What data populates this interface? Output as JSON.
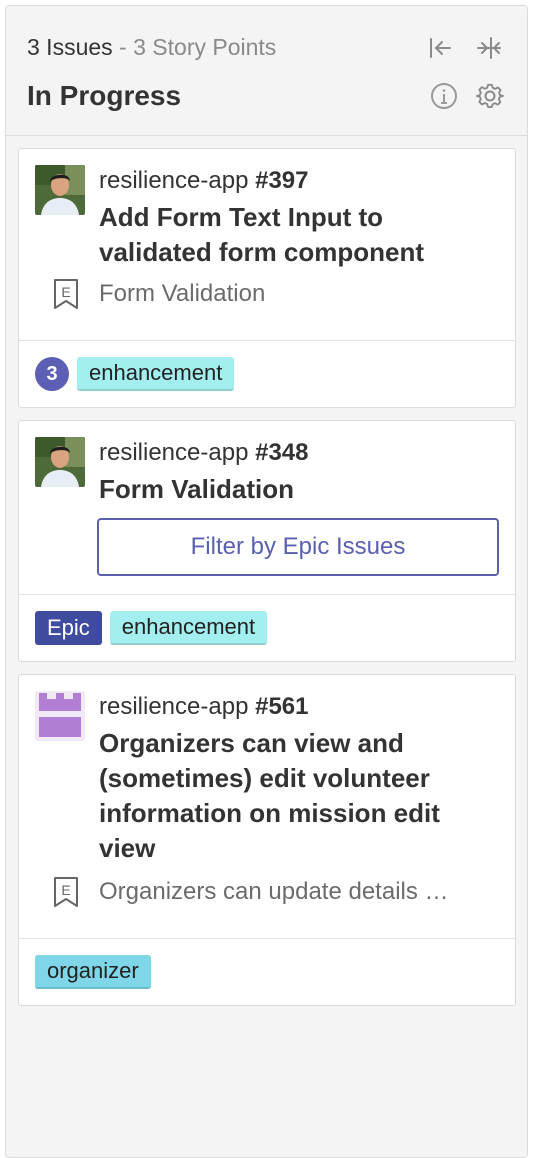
{
  "header": {
    "issues_count": "3 Issues",
    "separator": "-",
    "story_points": "3 Story Points",
    "title": "In Progress",
    "icons": [
      "collapse-left-icon",
      "collapse-horizontal-icon",
      "info-icon",
      "gear-icon"
    ]
  },
  "cards": [
    {
      "repo": "resilience-app",
      "number": "#397",
      "title": "Add Form Text Input to validated form component",
      "epic": "Form Validation",
      "estimate": "3",
      "labels": [
        "enhancement"
      ]
    },
    {
      "repo": "resilience-app",
      "number": "#348",
      "title": "Form Validation",
      "filter_button": "Filter by Epic Issues",
      "epic_badge": "Epic",
      "labels": [
        "enhancement"
      ]
    },
    {
      "repo": "resilience-app",
      "number": "#561",
      "title": "Organizers can view and (sometimes) edit volunteer information on mission edit view",
      "epic": "Organizers can update details …",
      "labels": [
        "organizer"
      ]
    }
  ],
  "colors": {
    "estimate_badge": "#5d5fb4",
    "label_enhancement": "#a3eeef",
    "label_organizer": "#7ed6e8",
    "label_epic": "#3e4b9e",
    "filter_button": "#5a5fae"
  }
}
